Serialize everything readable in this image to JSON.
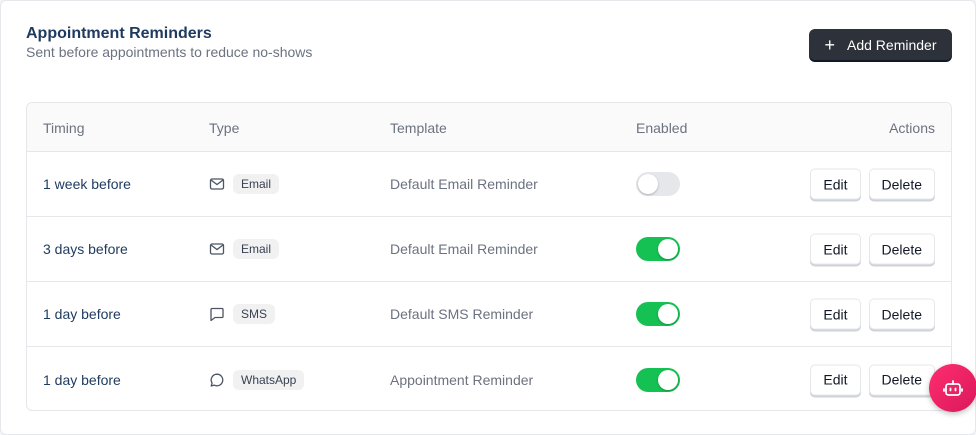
{
  "header": {
    "title": "Appointment Reminders",
    "subtitle": "Sent before appointments to reduce no-shows",
    "add_button_label": "Add Reminder",
    "add_button_icon": "plus-icon"
  },
  "table": {
    "columns": {
      "timing": "Timing",
      "type": "Type",
      "template": "Template",
      "enabled": "Enabled",
      "actions": "Actions"
    },
    "rows": [
      {
        "timing": "1 week before",
        "type": "Email",
        "type_icon": "mail-icon",
        "template": "Default Email Reminder",
        "enabled": false,
        "edit": "Edit",
        "delete": "Delete"
      },
      {
        "timing": "3 days before",
        "type": "Email",
        "type_icon": "mail-icon",
        "template": "Default Email Reminder",
        "enabled": true,
        "edit": "Edit",
        "delete": "Delete"
      },
      {
        "timing": "1 day before",
        "type": "SMS",
        "type_icon": "message-square-icon",
        "template": "Default SMS Reminder",
        "enabled": true,
        "edit": "Edit",
        "delete": "Delete"
      },
      {
        "timing": "1 day before",
        "type": "WhatsApp",
        "type_icon": "message-circle-icon",
        "template": "Appointment Reminder",
        "enabled": true,
        "edit": "Edit",
        "delete": "Delete"
      }
    ]
  },
  "colors": {
    "toggle_on": "#16c153",
    "toggle_off": "#e5e7eb",
    "primary_button": "#2d3139",
    "fab_gradient_start": "#ff2d6f",
    "fab_gradient_end": "#d9185c"
  },
  "fab": {
    "icon": "bot-icon"
  }
}
